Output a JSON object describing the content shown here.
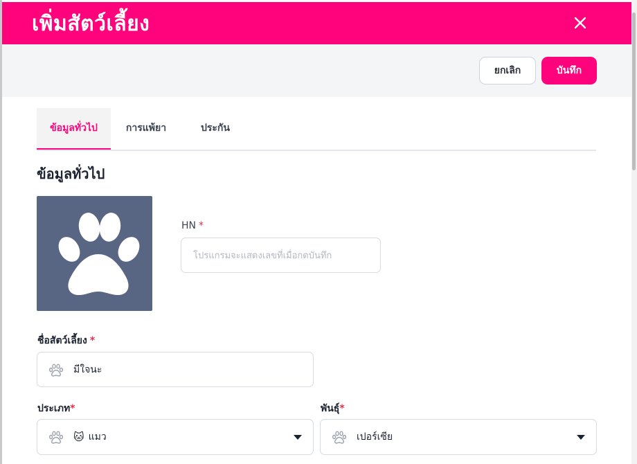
{
  "header": {
    "title": "เพิ่มสัตว์เลี้ยง",
    "close_icon": "close-icon"
  },
  "toolbar": {
    "cancel_label": "ยกเลิก",
    "save_label": "บันทึก"
  },
  "tabs": [
    {
      "label": "ข้อมูลทั่วไป",
      "active": true
    },
    {
      "label": "การแพ้ยา",
      "active": false
    },
    {
      "label": "ประกัน",
      "active": false
    }
  ],
  "section": {
    "title": "ข้อมูลทั่วไป"
  },
  "avatar": {
    "icon": "paw-icon"
  },
  "hn": {
    "label": "HN",
    "required_mark": "*",
    "placeholder": "โปรแกรมจะแสดงเลขที่เมื่อกดบันทึก"
  },
  "pet_name": {
    "label": "ชื่อสัตว์เลี้ยง",
    "required_mark": "*",
    "value": "มีใจนะ",
    "icon": "paw-icon"
  },
  "pet_type": {
    "label": "ประเภท",
    "required_mark": "*",
    "emoji": "🐱",
    "value": "แมว",
    "icon": "paw-icon"
  },
  "breed": {
    "label": "พันธุ์",
    "required_mark": "*",
    "value": "เปอร์เซีย",
    "icon": "paw-icon"
  },
  "colors": {
    "brand": "#ff037d",
    "avatar_bg": "#596683",
    "required": "#e0314a"
  }
}
